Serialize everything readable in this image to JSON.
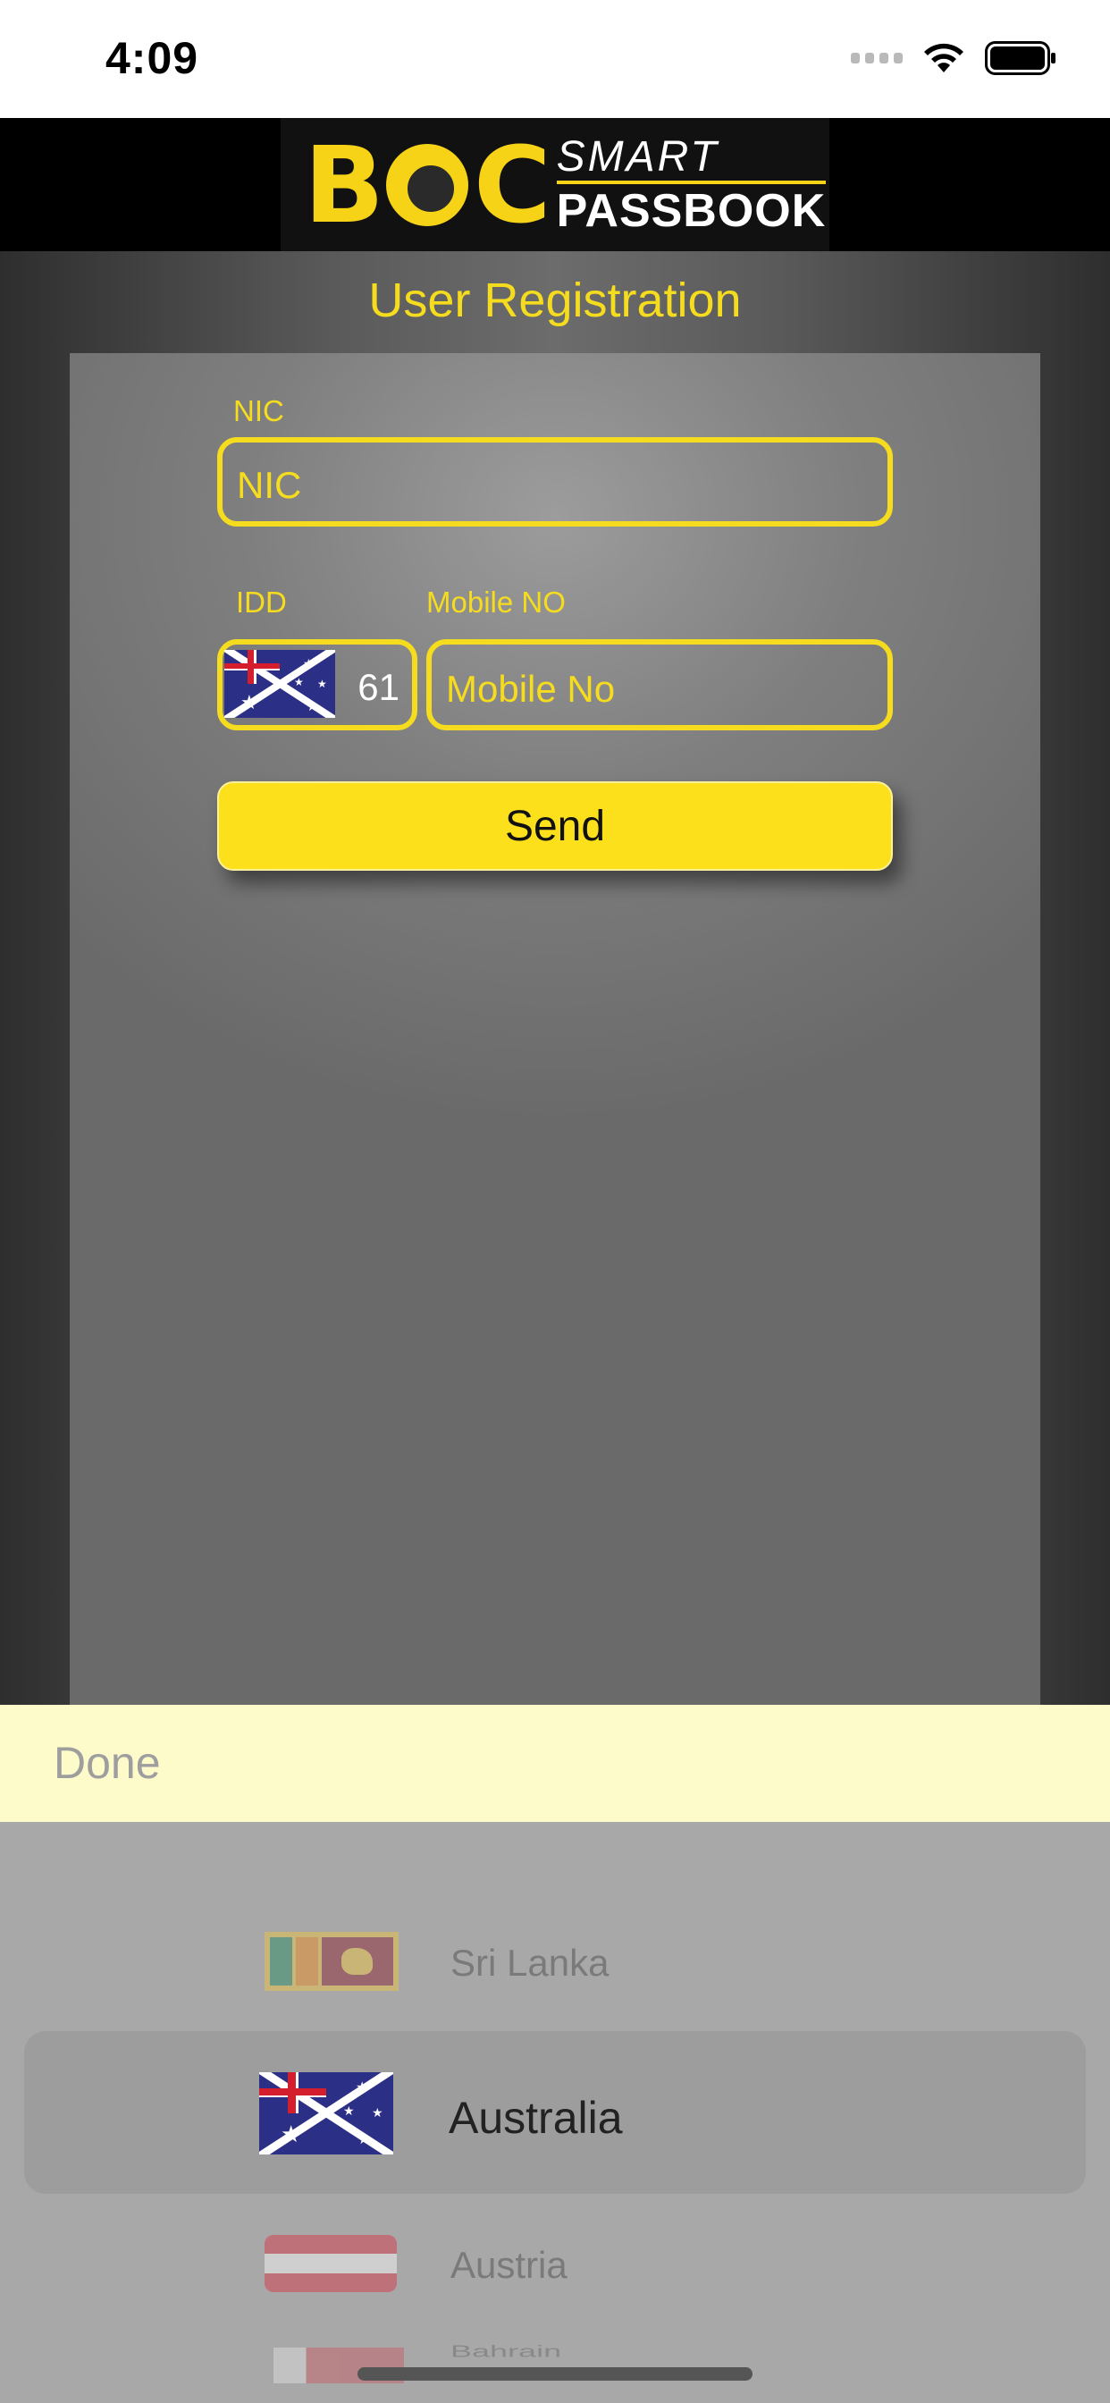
{
  "status_bar": {
    "time": "4:09"
  },
  "header": {
    "logo_letters": "BOC",
    "logo_smart": "SMART",
    "logo_passbook": "PASSBOOK"
  },
  "page": {
    "title": "User Registration"
  },
  "form": {
    "nic_label": "NIC",
    "nic_placeholder": "NIC",
    "idd_label": "IDD",
    "idd_value": "61",
    "idd_flag": "australia-flag",
    "mobile_label": "Mobile NO",
    "mobile_placeholder": "Mobile No",
    "send_label": "Send"
  },
  "picker": {
    "done_label": "Done",
    "selected_index": 1,
    "items": [
      {
        "label": "Sri Lanka",
        "flag": "sri-lanka-flag"
      },
      {
        "label": "Australia",
        "flag": "australia-flag"
      },
      {
        "label": "Austria",
        "flag": "austria-flag"
      },
      {
        "label": "Bahrain",
        "flag": "bahrain-flag"
      }
    ]
  },
  "colors": {
    "accent_yellow": "#f6dc1e",
    "button_yellow": "#fde01c",
    "toolbar_bg": "#fefbca",
    "picker_bg": "#a8a8a8"
  }
}
